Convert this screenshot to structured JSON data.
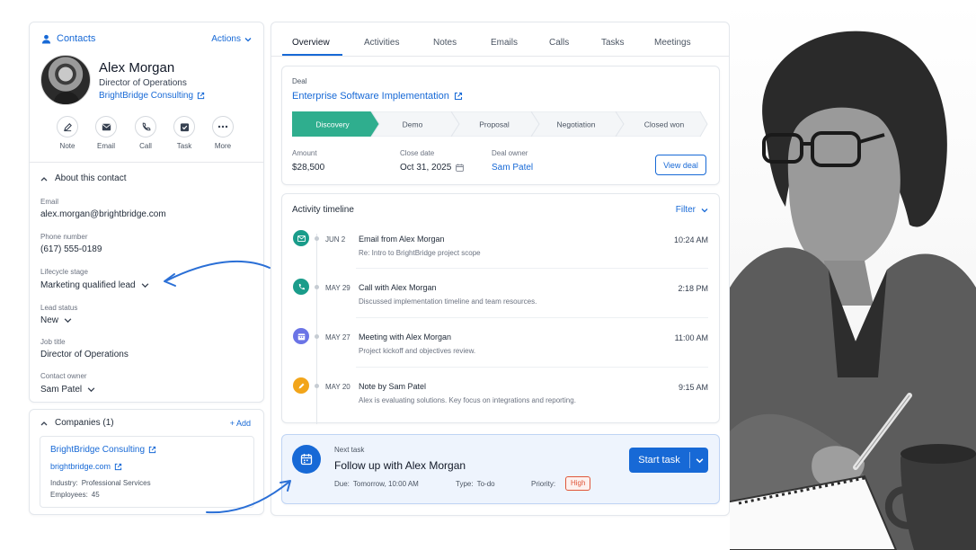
{
  "contact": {
    "section_label": "Contacts",
    "actions_label": "Actions",
    "name": "Alex Morgan",
    "title": "Director of Operations",
    "company": "BrightBridge Consulting",
    "quick_actions": [
      "Note",
      "Email",
      "Call",
      "Task",
      "More"
    ],
    "about_title": "About this contact",
    "fields": [
      {
        "label": "Email",
        "value": "alex.morgan@brightbridge.com"
      },
      {
        "label": "Phone number",
        "value": "(617) 555-0189"
      },
      {
        "label": "Lifecycle stage",
        "value": "Marketing qualified lead"
      },
      {
        "label": "Lead status",
        "value": "New"
      },
      {
        "label": "Job title",
        "value": "Director of Operations"
      },
      {
        "label": "Contact owner",
        "value": "Sam Patel"
      }
    ]
  },
  "companies": {
    "title": "Companies (1)",
    "add_label": "+ Add",
    "name": "BrightBridge Consulting",
    "domain": "brightbridge.com",
    "industry_label": "Industry:",
    "industry": "Professional Services",
    "employees_label": "Employees:",
    "employees": "45"
  },
  "tabs": [
    "Overview",
    "Activities",
    "Notes",
    "Emails",
    "Calls",
    "Tasks",
    "Meetings"
  ],
  "deal": {
    "label": "Deal",
    "name": "Enterprise Software Implementation",
    "stages": [
      "Discovery",
      "Demo",
      "Proposal",
      "Negotiation",
      "Closed won"
    ],
    "active_stage": "Discovery",
    "amount_label": "Amount",
    "amount": "$28,500",
    "close_label": "Close date",
    "close_date": "Oct 31, 2025",
    "owner_label": "Deal owner",
    "owner": "Sam Patel",
    "view_label": "View deal"
  },
  "timeline": {
    "title": "Activity timeline",
    "filter_label": "Filter",
    "items": [
      {
        "date": "JUN 2",
        "title": "Email from Alex Morgan",
        "subtitle": "Re: Intro to BrightBridge project scope",
        "time": "10:24 AM",
        "icon": "mail-icon",
        "color": "#1a9c8a"
      },
      {
        "date": "MAY 29",
        "title": "Call with Alex Morgan",
        "subtitle": "Discussed implementation timeline and team resources.",
        "time": "2:18 PM",
        "icon": "phone-icon",
        "color": "#1a9c8a"
      },
      {
        "date": "MAY 27",
        "title": "Meeting with Alex Morgan",
        "subtitle": "Project kickoff and objectives review.",
        "time": "11:00 AM",
        "icon": "calendar-icon",
        "color": "#6b74e6"
      },
      {
        "date": "MAY 20",
        "title": "Note by Sam Patel",
        "subtitle": "Alex is evaluating solutions. Key focus on integrations and reporting.",
        "time": "9:15 AM",
        "icon": "note-icon",
        "color": "#f2a51a"
      }
    ]
  },
  "next_task": {
    "label": "Next task",
    "title": "Follow up with Alex Morgan",
    "due_label": "Due:",
    "due": "Tomorrow, 10:00 AM",
    "type_label": "Type:",
    "type": "To-do",
    "priority_label": "Priority:",
    "priority": "High",
    "button_label": "Start task"
  },
  "colors": {
    "accent": "#1769d6",
    "stage_active": "#2fae8e",
    "priority_high": "#e0573a"
  }
}
